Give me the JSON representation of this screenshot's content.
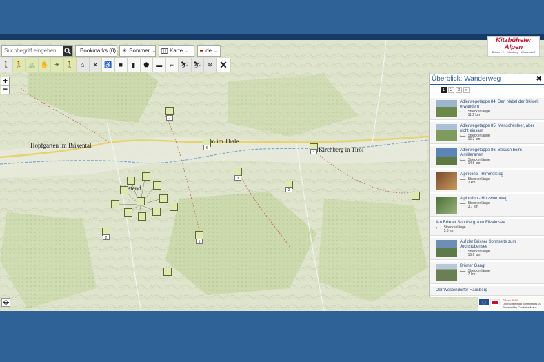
{
  "toolbar": {
    "search_placeholder": "Suchbegriff eingeben",
    "bookmarks_label": "Bookmarks (0)",
    "season_label": "Sommer",
    "map_label": "Karte",
    "language_label": "de"
  },
  "filters": [
    {
      "icon": "hiking-person-icon",
      "style": "active"
    },
    {
      "icon": "running-icon",
      "style": "green"
    },
    {
      "icon": "cycling-icon",
      "style": "green"
    },
    {
      "icon": "climbing-icon",
      "style": "green"
    },
    {
      "icon": "sun-icon",
      "style": "green"
    },
    {
      "icon": "walking-icon",
      "style": "green"
    },
    {
      "icon": "hut-icon",
      "style": "grey"
    },
    {
      "icon": "tools-icon",
      "style": "grey"
    },
    {
      "icon": "accessibility-icon",
      "style": "white"
    },
    {
      "icon": "shopping-bag-icon",
      "style": "white"
    },
    {
      "icon": "document-icon",
      "style": "white"
    },
    {
      "icon": "house-icon",
      "style": "white"
    },
    {
      "icon": "parking-icon",
      "style": "white"
    },
    {
      "icon": "bus-icon",
      "style": "white"
    },
    {
      "icon": "skiing-icon",
      "style": "grey"
    },
    {
      "icon": "cross-country-icon",
      "style": "grey"
    },
    {
      "icon": "snowflake-icon",
      "style": "grey"
    }
  ],
  "map_labels": [
    {
      "text": "Hopfgarten im Brixental",
      "size": "big"
    },
    {
      "text": "Kirchberg in Tirol",
      "size": "big"
    },
    {
      "text": "m im Thale",
      "size": "big"
    },
    {
      "text": "Westend",
      "size": "big"
    }
  ],
  "markers": [
    {
      "count": "2"
    },
    {
      "count": "6"
    },
    {
      "count": "4"
    },
    {
      "count": "3"
    },
    {
      "count": "2"
    },
    {
      "count": "2"
    },
    {
      "count": "5"
    }
  ],
  "logo": {
    "line1": "Kitzbüheler",
    "line2": "Alpen",
    "line3": "Brixen i.T. · Kirchberg · Westendorf"
  },
  "panel": {
    "title": "Überblick: Wanderweg",
    "pages": [
      "1",
      "2",
      "3",
      "»"
    ],
    "results": [
      {
        "title": "Adlerwegetappe 84: Den Nabel der Skiwelt erwandern",
        "meta_label": "Streckenlänge",
        "meta_value": "11.2 km",
        "thumb": "#6b8a4a"
      },
      {
        "title": "Adlerwegetappe 85: Menschenleer, aber nicht einsam",
        "meta_label": "Streckenlänge",
        "meta_value": "16.2 km",
        "thumb": "#7e9a5c"
      },
      {
        "title": "Adlerwegetappe 86: Besuch beim Almliterarten",
        "meta_label": "Streckenlänge",
        "meta_value": "14.6 km",
        "thumb": "#5b84b8"
      },
      {
        "title": "Alpinolino - Himmelsteg",
        "meta_label": "Streckenlänge",
        "meta_value": "2 km",
        "thumb": "#7a4a30"
      },
      {
        "title": "Alpinolino - Holzwurmweg",
        "meta_label": "Streckenlänge",
        "meta_value": "3.7 km",
        "thumb": "#4a6e3a"
      },
      {
        "title": "Am Brixner Sonnberg zum Filzalmsee",
        "meta_label": "Streckenlänge",
        "meta_value": "5.6 km",
        "thumb": ""
      },
      {
        "title": "Auf der Brixner Sonnseite zum Jochstubensee",
        "meta_label": "Streckenlänge",
        "meta_value": "15.6 km",
        "thumb": "#6d8fb5"
      },
      {
        "title": "Brixner Gangl",
        "meta_label": "Streckenlänge",
        "meta_value": "7 km",
        "thumb": "#6a7f52"
      },
      {
        "title": "Der Westendorfer Hausberg",
        "meta_label": "",
        "meta_value": "",
        "thumb": ""
      }
    ]
  },
  "attribution": {
    "line1": "© Mair 2014",
    "line2": "OpenStreetMap contributors 20",
    "line3": "Powered by Contwise Maps"
  },
  "colors": {
    "background": "#2f6398",
    "accent": "#2a5d96",
    "marker_fill": "#dfe8b0",
    "brand_red": "#c8102e"
  }
}
